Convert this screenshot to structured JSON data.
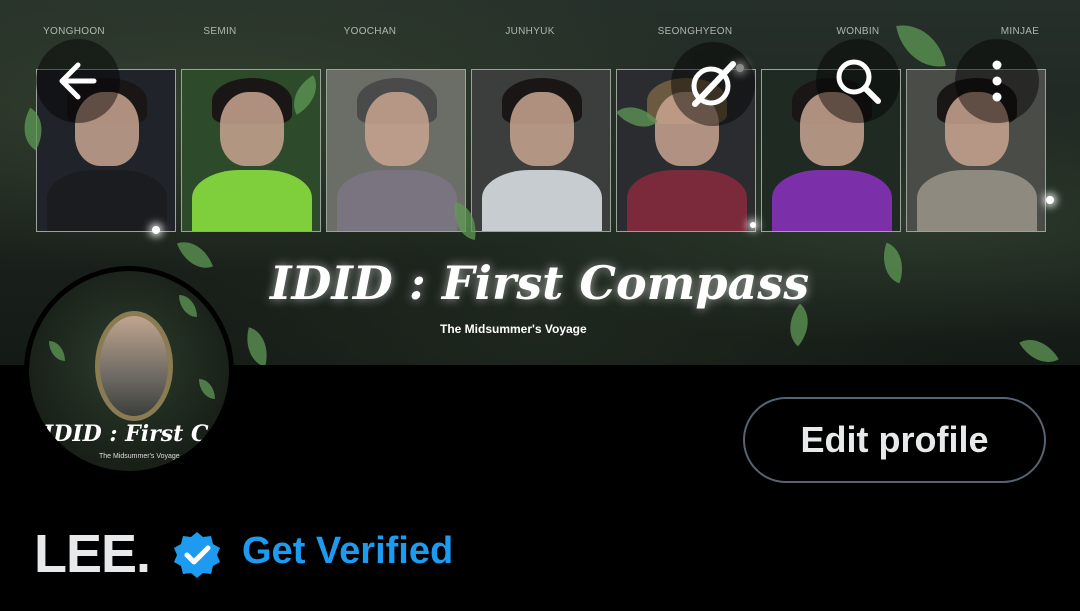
{
  "banner": {
    "member_names": [
      "YONGHOON",
      "SEMIN",
      "YOOCHAN",
      "JUNHYUK",
      "SEONGHYEON",
      "WONBIN",
      "MINJAE"
    ],
    "album_title": "IDID : First Compass",
    "album_subtitle": "The Midsummer's Voyage"
  },
  "toolbar": {
    "back_icon": "arrow-left-icon",
    "grok_icon": "grok-icon",
    "search_icon": "search-icon",
    "more_icon": "more-vertical-icon"
  },
  "avatar": {
    "text": "IDID : First Compass",
    "subtext": "The Midsummer's Voyage"
  },
  "profile": {
    "edit_label": "Edit profile",
    "display_name": "LEE.",
    "get_verified_label": "Get Verified",
    "verified_icon": "verified-badge-icon"
  },
  "colors": {
    "accent_blue": "#1d9bf0",
    "text_primary": "#e7e9ea",
    "button_border": "#566370",
    "background": "#000000"
  }
}
